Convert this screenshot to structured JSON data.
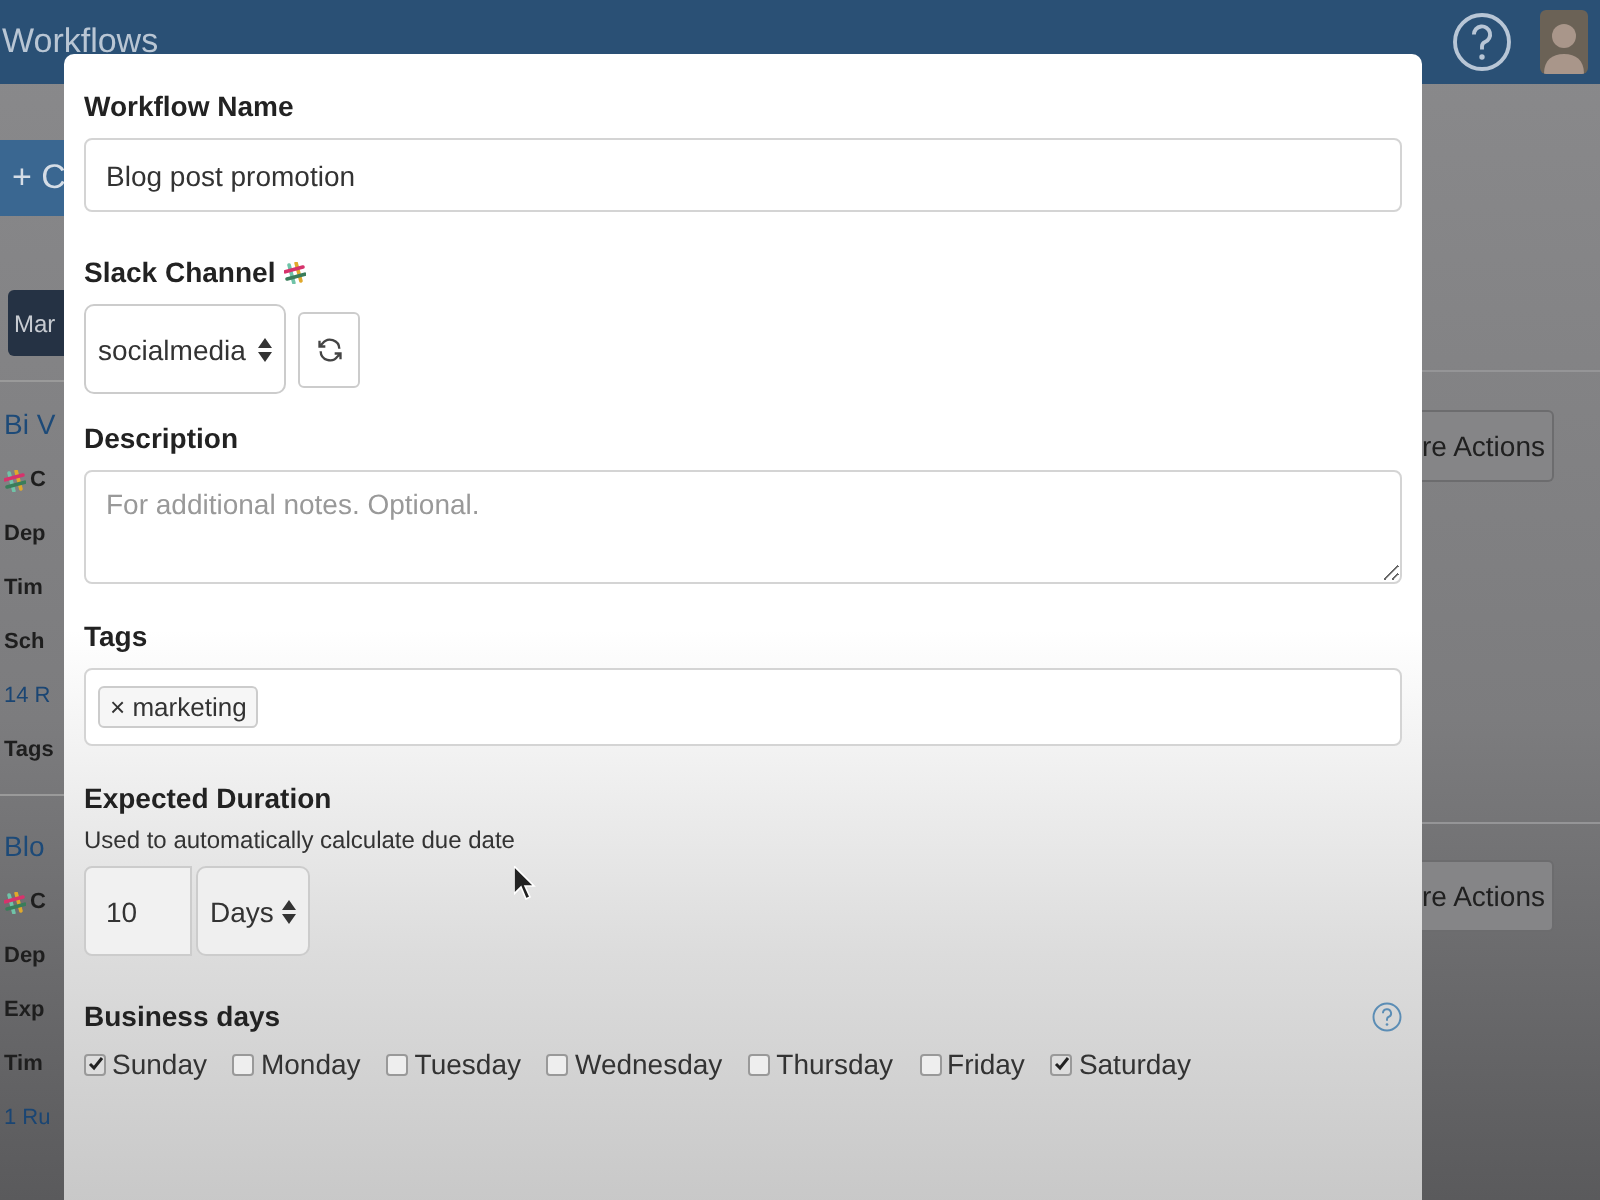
{
  "header": {
    "title": "Workflows"
  },
  "background": {
    "create_button": "+ C",
    "tab_button": "Mar",
    "cards": [
      {
        "title": "Bi V",
        "channel": "C",
        "fields": [
          "Dep",
          "Tim",
          "Sch"
        ],
        "link": "14 R",
        "tags_label": "Tags",
        "actions_button": "re Actions"
      },
      {
        "title": "Blo",
        "channel": "C",
        "fields": [
          "Dep",
          "Exp",
          "Tim"
        ],
        "link": "1 Ru",
        "actions_button": "re Actions"
      }
    ]
  },
  "modal": {
    "name": {
      "label": "Workflow Name",
      "value": "Blog post promotion"
    },
    "slack": {
      "label": "Slack Channel",
      "value": "socialmedia"
    },
    "description": {
      "label": "Description",
      "placeholder": "For additional notes. Optional."
    },
    "tags": {
      "label": "Tags",
      "items": [
        {
          "label": "marketing",
          "remove": "×"
        }
      ]
    },
    "duration": {
      "label": "Expected Duration",
      "hint": "Used to automatically calculate due date",
      "amount": "10",
      "unit": "Days"
    },
    "business_days": {
      "label": "Business days",
      "days": [
        {
          "label": "Sunday",
          "checked": true
        },
        {
          "label": "Monday",
          "checked": false
        },
        {
          "label": "Tuesday",
          "checked": false
        },
        {
          "label": "Wednesday",
          "checked": false
        },
        {
          "label": "Thursday",
          "checked": false
        },
        {
          "label": "Friday",
          "checked": false
        },
        {
          "label": "Saturday",
          "checked": true
        }
      ]
    }
  }
}
